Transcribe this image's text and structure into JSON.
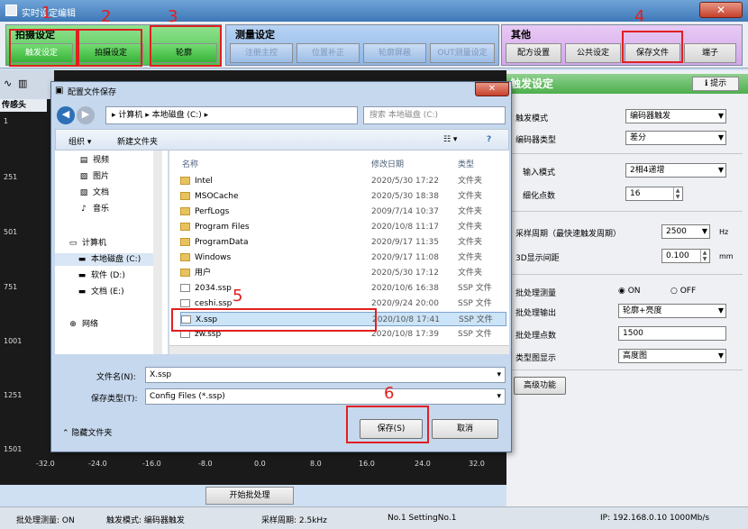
{
  "window": {
    "title": "实时设定编辑",
    "close_label": "✕"
  },
  "toolbar": {
    "groups": [
      {
        "title": "拍摄设定",
        "buttons": [
          "触发设定",
          "拍摄设定",
          "轮廓"
        ]
      },
      {
        "title": "测量设定",
        "buttons": [
          "注册主控",
          "位置补正",
          "轮廓屏蔽",
          "OUT测量设定"
        ]
      },
      {
        "title": "其他",
        "buttons": [
          "配方设置",
          "公共设定",
          "保存文件",
          "端子"
        ]
      }
    ]
  },
  "graph": {
    "sensor_label": "传感头",
    "y_ticks": [
      "1",
      "251",
      "501",
      "751",
      "1001",
      "1251",
      "1501"
    ],
    "x_ticks": [
      "-32.0",
      "-24.0",
      "-16.0",
      "-8.0",
      "0.0",
      "8.0",
      "16.0",
      "24.0",
      "32.0"
    ],
    "start_button": "开始批处理"
  },
  "right_panel": {
    "header": "触发设定",
    "hint_button": "提示",
    "trigger_mode": {
      "label": "触发模式",
      "value": "编码器触发"
    },
    "encoder_type": {
      "label": "编码器类型",
      "value": "差分"
    },
    "input_mode": {
      "label": "输入模式",
      "value": "2相4递增"
    },
    "subdivide": {
      "label": "细化点数",
      "value": "16"
    },
    "sample_period": {
      "label": "采样周期（最快速触发周期）",
      "value": "2500",
      "unit": "Hz"
    },
    "display_spacing": {
      "label": "3D显示间距",
      "value": "0.100",
      "unit": "mm"
    },
    "batch": {
      "label": "批处理测量",
      "on": "ON",
      "off": "OFF"
    },
    "batch_output": {
      "label": "批处理输出",
      "value": "轮廓+亮度"
    },
    "batch_points": {
      "label": "批处理点数",
      "value": "1500"
    },
    "chart_type": {
      "label": "类型图显示",
      "value": "高度图"
    },
    "advanced_button": "高级功能"
  },
  "status": {
    "batch": "批处理测量: ON",
    "trigger": "触发模式: 编码器触发",
    "period": "采样周期: 2.5kHz",
    "setting": "No.1 SettingNo.1",
    "ip": "IP: 192.168.0.10 1000Mb/s"
  },
  "dialog": {
    "title": "配置文件保存",
    "close_label": "✕",
    "address": "▸ 计算机 ▸ 本地磁盘 (C:) ▸",
    "search_placeholder": "搜索 本地磁盘 (C:)",
    "organize": "组织 ▾",
    "new_folder": "新建文件夹",
    "nav_items": [
      "视频",
      "图片",
      "文档",
      "音乐",
      "计算机",
      "本地磁盘 (C:)",
      "软件 (D:)",
      "文档 (E:)",
      "网络"
    ],
    "col_name": "名称",
    "col_date": "修改日期",
    "col_type": "类型",
    "files": [
      {
        "name": "Intel",
        "date": "2020/5/30 17:22",
        "type": "文件夹",
        "kind": "folder"
      },
      {
        "name": "MSOCache",
        "date": "2020/5/30 18:38",
        "type": "文件夹",
        "kind": "folder"
      },
      {
        "name": "PerfLogs",
        "date": "2009/7/14 10:37",
        "type": "文件夹",
        "kind": "folder"
      },
      {
        "name": "Program Files",
        "date": "2020/10/8 11:17",
        "type": "文件夹",
        "kind": "folder"
      },
      {
        "name": "ProgramData",
        "date": "2020/9/17 11:35",
        "type": "文件夹",
        "kind": "folder"
      },
      {
        "name": "Windows",
        "date": "2020/9/17 11:08",
        "type": "文件夹",
        "kind": "folder"
      },
      {
        "name": "用户",
        "date": "2020/5/30 17:12",
        "type": "文件夹",
        "kind": "folder"
      },
      {
        "name": "2034.ssp",
        "date": "2020/10/6 16:38",
        "type": "SSP 文件",
        "kind": "file"
      },
      {
        "name": "ceshi.ssp",
        "date": "2020/9/24 20:00",
        "type": "SSP 文件",
        "kind": "file"
      },
      {
        "name": "X.ssp",
        "date": "2020/10/8 17:41",
        "type": "SSP 文件",
        "kind": "file"
      },
      {
        "name": "zw.ssp",
        "date": "2020/10/8 17:39",
        "type": "SSP 文件",
        "kind": "file"
      }
    ],
    "filename_label": "文件名(N):",
    "filename_value": "X.ssp",
    "filetype_label": "保存类型(T):",
    "filetype_value": "Config Files (*.ssp)",
    "hide_folders": "隐藏文件夹",
    "save_button": "保存(S)",
    "cancel_button": "取消"
  },
  "annotations": [
    "1",
    "2",
    "3",
    "4",
    "5",
    "6"
  ],
  "colors": {
    "annotation": "#e02020",
    "green_group": "#4cc24c",
    "blue_group": "#8fb5e6",
    "purple_group": "#d3a7ea"
  }
}
